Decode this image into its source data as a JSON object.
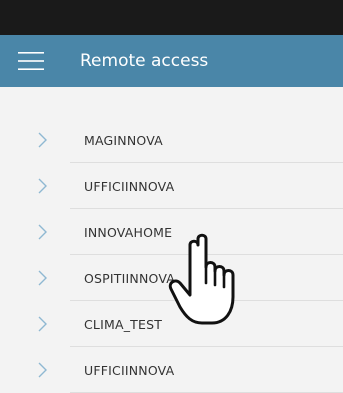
{
  "header": {
    "title": "Remote access",
    "menu_icon": "hamburger-menu-icon",
    "bar_color": "#4a86a8"
  },
  "sites": [
    {
      "label": "MAGINNOVA"
    },
    {
      "label": "UFFICIINNOVA"
    },
    {
      "label": "INNOVAHOME"
    },
    {
      "label": "OSPITIINNOVA"
    },
    {
      "label": "CLIMA_TEST"
    },
    {
      "label": "UFFICIINNOVA"
    }
  ],
  "overlay": {
    "pointer_icon": "hand-pointer-icon"
  }
}
